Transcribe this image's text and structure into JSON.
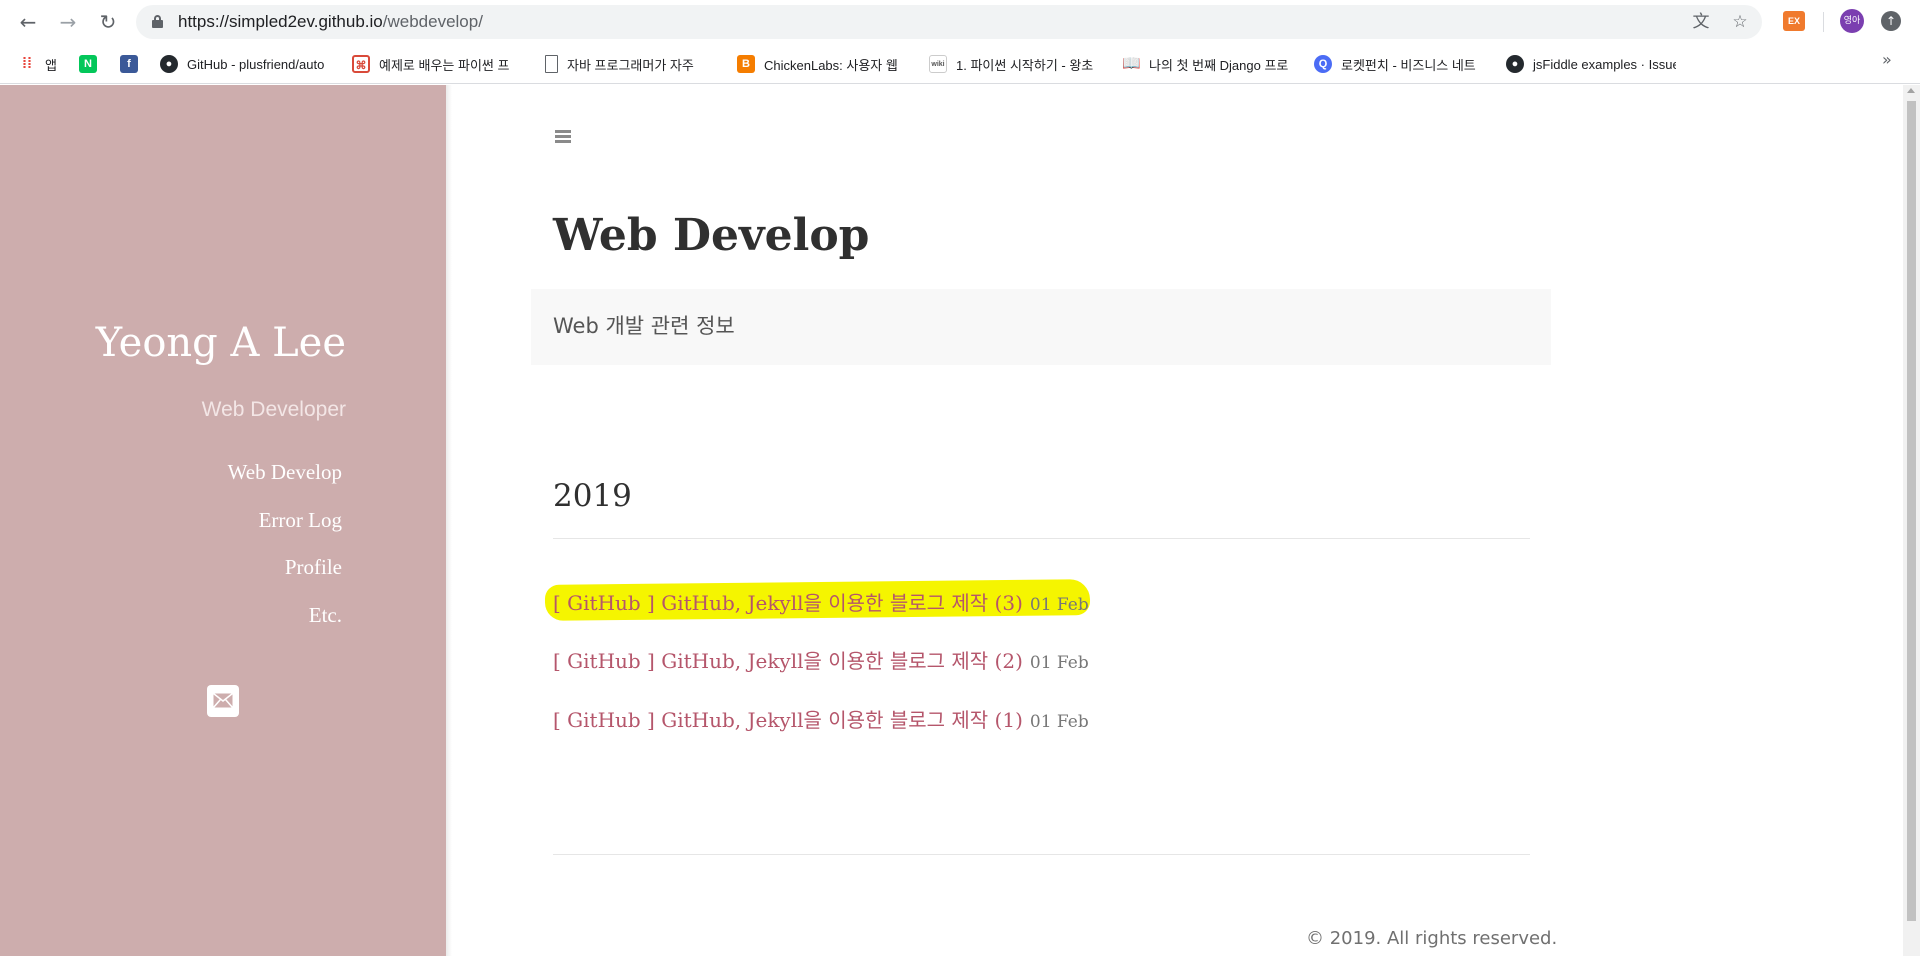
{
  "browser": {
    "url_host": "https://simpled2ev.github.io",
    "url_path": "/webdevelop/",
    "extension_badge": "EX",
    "profile_initials": "영아"
  },
  "bookmarks": [
    {
      "label": "앱",
      "icon": "apps-grid-icon",
      "color": "#e8453c"
    },
    {
      "label": "",
      "icon": "naver-icon",
      "color": "#03c75a"
    },
    {
      "label": "",
      "icon": "facebook-icon",
      "color": "#3b5998"
    },
    {
      "label": "GitHub - plusfriend/auto",
      "icon": "github-icon",
      "color": "#24292e"
    },
    {
      "label": "예제로 배우는 파이썬 프",
      "icon": "python-course-icon",
      "color": "#d94a3a"
    },
    {
      "label": "자바 프로그래머가 자주",
      "icon": "document-icon",
      "color": "#5f6368"
    },
    {
      "label": "ChickenLabs: 사용자 웹",
      "icon": "blogger-icon",
      "color": "#f57d00"
    },
    {
      "label": "1. 파이썬 시작하기 - 왕초",
      "icon": "wikidocs-icon",
      "color": "#555555"
    },
    {
      "label": "나의 첫 번째 Django 프로",
      "icon": "book-icon",
      "color": "#333333"
    },
    {
      "label": "로켓펀치 - 비즈니스 네트",
      "icon": "rocketpunch-icon",
      "color": "#4b6cf5"
    },
    {
      "label": "jsFiddle examples · Issue",
      "icon": "github-icon",
      "color": "#24292e"
    }
  ],
  "sidebar": {
    "title": "Yeong A Lee",
    "subtitle": "Web Developer",
    "nav": [
      "Web Develop",
      "Error Log",
      "Profile",
      "Etc."
    ],
    "accent": "#cdadad"
  },
  "main": {
    "title": "Web Develop",
    "lead": "Web 개발 관련 정보",
    "year": "2019",
    "posts": [
      {
        "title": "[ GitHub ] GitHub, Jekyll을 이용한 블로그 제작 (3)",
        "date": "01 Feb",
        "highlighted": true
      },
      {
        "title": "[ GitHub ] GitHub, Jekyll을 이용한 블로그 제작 (2)",
        "date": "01 Feb",
        "highlighted": false
      },
      {
        "title": "[ GitHub ] GitHub, Jekyll을 이용한 블로그 제작 (1)",
        "date": "01 Feb",
        "highlighted": false
      }
    ],
    "link_color": "#b5566b",
    "highlight_color": "#f5f500"
  },
  "footer": {
    "copyright": "© 2019. All rights reserved."
  }
}
